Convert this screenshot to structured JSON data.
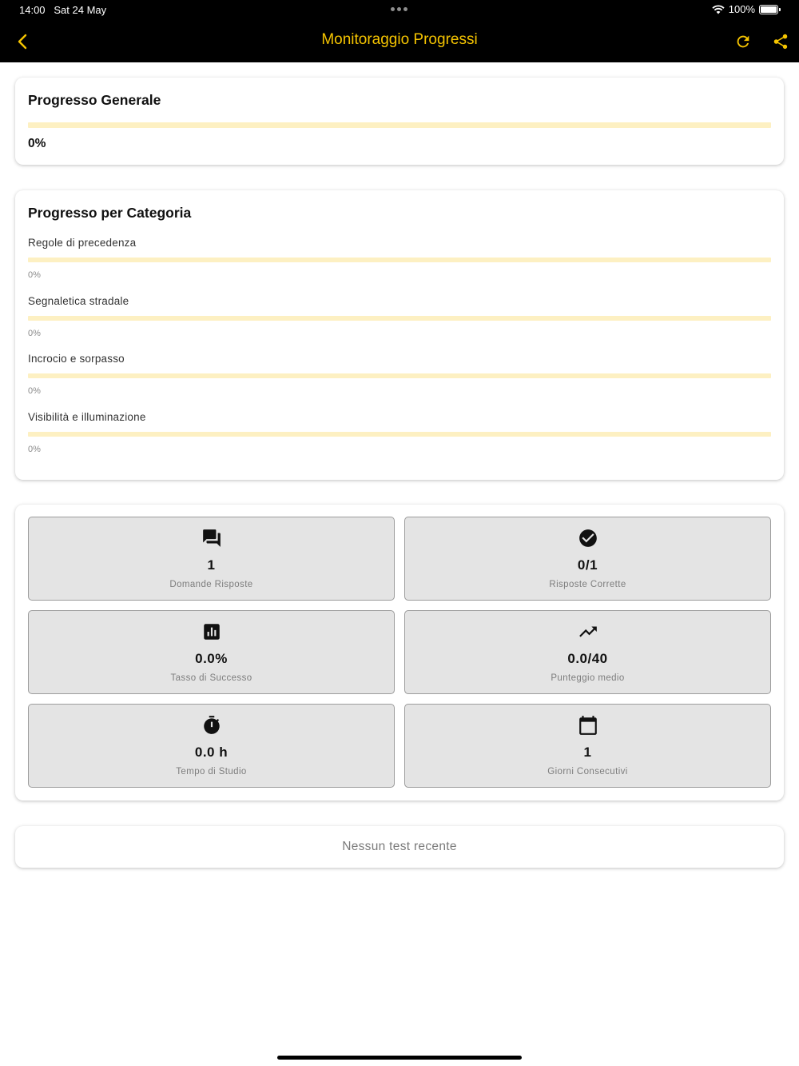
{
  "status_bar": {
    "time": "14:00",
    "date": "Sat 24 May",
    "battery": "100%"
  },
  "nav": {
    "title": "Monitoraggio Progressi",
    "back_icon": "chevron-left",
    "refresh_icon": "refresh",
    "share_icon": "share",
    "accent_color": "#f5c400"
  },
  "overall": {
    "title": "Progresso Generale",
    "value_label": "0%",
    "progress": 0
  },
  "categories": {
    "title": "Progresso per Categoria",
    "items": [
      {
        "label": "Regole di precedenza",
        "pct_label": "0%",
        "progress": 0
      },
      {
        "label": "Segnaletica stradale",
        "pct_label": "0%",
        "progress": 0
      },
      {
        "label": "Incrocio e sorpasso",
        "pct_label": "0%",
        "progress": 0
      },
      {
        "label": "Visibilità e illuminazione",
        "pct_label": "0%",
        "progress": 0
      }
    ]
  },
  "stats": [
    {
      "icon": "forum",
      "value": "1",
      "label": "Domande Risposte"
    },
    {
      "icon": "check-circle",
      "value": "0/1",
      "label": "Risposte Corrette"
    },
    {
      "icon": "bar-chart",
      "value": "0.0%",
      "label": "Tasso di Successo"
    },
    {
      "icon": "trending-up",
      "value": "0.0/40",
      "label": "Punteggio medio"
    },
    {
      "icon": "timer",
      "value": "0.0 h",
      "label": "Tempo di Studio"
    },
    {
      "icon": "calendar",
      "value": "1",
      "label": "Giorni Consecutivi"
    }
  ],
  "recent_tests": {
    "empty_text": "Nessun test recente"
  }
}
